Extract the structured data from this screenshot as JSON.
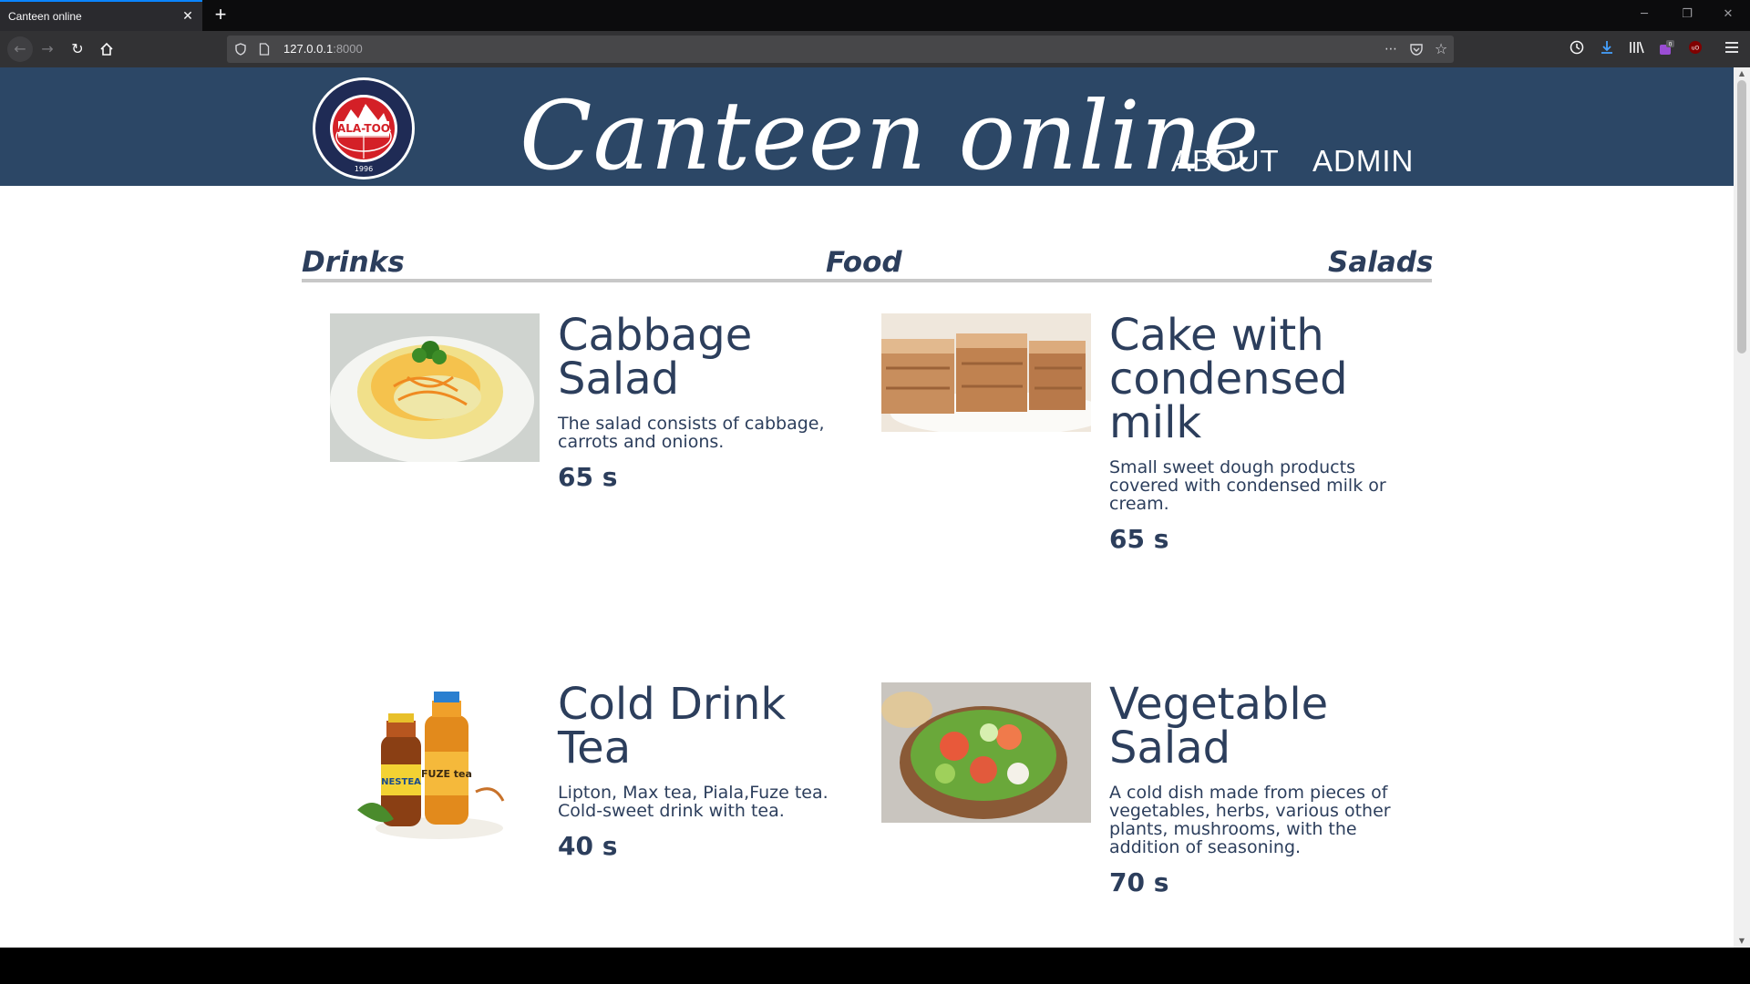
{
  "browser": {
    "tab_title": "Canteen online",
    "tab_close": "✕",
    "new_tab": "+",
    "url_host": "127.0.0.1",
    "url_port": ":8000",
    "window_controls": [
      "─",
      "❐",
      "✕"
    ]
  },
  "header": {
    "brand": "Canteen online",
    "logo": {
      "ring_text": "ALA-TOO INTERNATIONAL UNIVERSITY",
      "center_text": "ALA-TOO",
      "year": "1996"
    },
    "links": [
      "ABOUT",
      "ADMIN"
    ]
  },
  "categories": [
    "Drinks",
    "Food",
    "Salads"
  ],
  "items": [
    {
      "title": "Cabbage Salad",
      "description": "The salad consists of cabbage, carrots and onions.",
      "price": "65 s",
      "image_icon": "cabbage-salad-photo"
    },
    {
      "title": "Cake with condensed milk",
      "description": "Small sweet dough products covered with condensed milk or cream.",
      "price": "65 s",
      "image_icon": "cake-photo"
    },
    {
      "title": "Cold Drink Tea",
      "description": "Lipton, Max tea, Piala,Fuze tea. Cold-sweet drink with tea.",
      "price": "40 s",
      "image_icon": "iced-tea-bottles-photo",
      "bottle_labels": [
        "NESTEA",
        "FUZE tea"
      ]
    },
    {
      "title": "Vegetable Salad",
      "description": "A cold dish made from pieces of vegetables, herbs, various other plants, mushrooms, with the addition of seasoning.",
      "price": "70 s",
      "image_icon": "vegetable-salad-photo"
    }
  ],
  "colors": {
    "header_bg": "#2c4766",
    "text": "#2c3e5c",
    "logo_red": "#d42027",
    "logo_navy": "#1f2b55"
  }
}
